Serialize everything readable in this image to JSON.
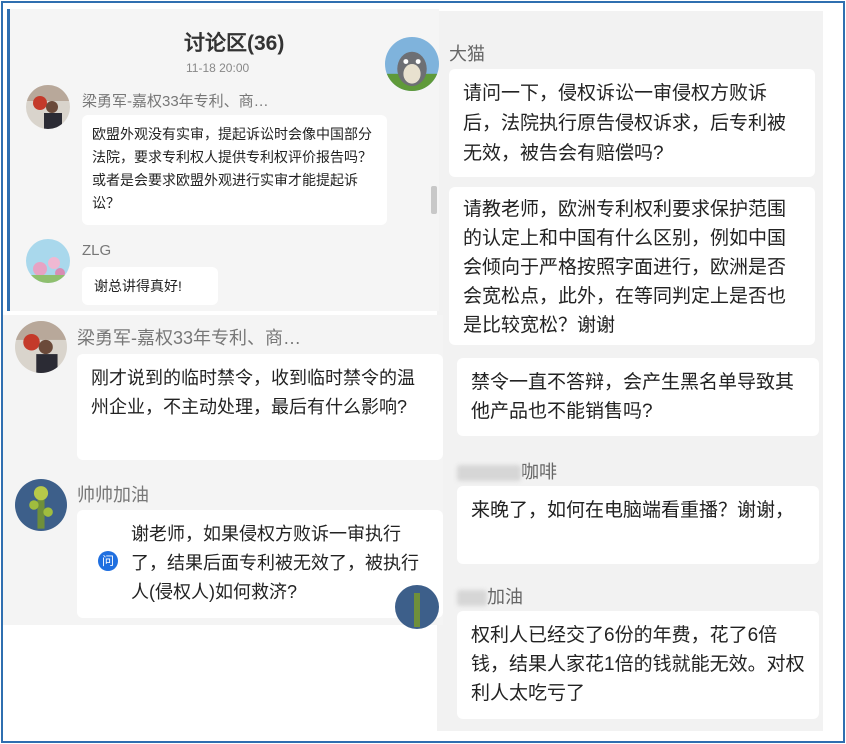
{
  "discussion": {
    "title": "讨论区(36)",
    "timestamp": "11-18 20:00"
  },
  "left_messages": [
    {
      "author": "梁勇军-嘉权33年专利、商…",
      "text": "欧盟外观没有实审，提起诉讼时会像中国部分法院，要求专利权人提供专利权评价报告吗？或者是会要求欧盟外观进行实审才能提起诉讼？",
      "avatar": "office-photo-avatar"
    },
    {
      "author": "ZLG",
      "text": "谢总讲得真好!",
      "avatar": "flower-avatar"
    },
    {
      "author": "梁勇军-嘉权33年专利、商…",
      "text": "刚才说到的临时禁令，收到临时禁令的温州企业，不主动处理，最后有什么影响?",
      "avatar": "office-photo-avatar"
    },
    {
      "author": "帅帅加油",
      "text": "谢老师，如果侵权方败诉一审执行了，结果后面专利被无效了，被执行人(侵权人)如何救济?",
      "avatar": "plant-avatar",
      "badge": "问"
    }
  ],
  "right_messages": [
    {
      "author": "大猫",
      "text": "请问一下，侵权诉讼一审侵权方败诉后，法院执行原告侵权诉求，后专利被无效，被告会有赔偿吗?",
      "avatar": "totoro-avatar"
    },
    {
      "author": "",
      "text": "请教老师，欧洲专利权利要求保护范围的认定上和中国有什么区别，例如中国会倾向于严格按照字面进行，欧洲是否会宽松点，此外，在等同判定上是否也是比较宽松？谢谢"
    },
    {
      "author": "",
      "text": "禁令一直不答辩，会产生黑名单导致其他产品也不能销售吗?"
    },
    {
      "author": "咖啡",
      "text": "来晚了，如何在电脑端看重播？谢谢，",
      "blurred_prefix": true
    },
    {
      "author": "加油",
      "text": "权利人已经交了6份的年费，花了6倍钱，结果人家花1倍的钱就能无效。对权利人太吃亏了",
      "blurred_prefix": true
    }
  ],
  "colors": {
    "frame": "#2f6fb0",
    "panel": "#f2f2f2",
    "badge": "#1f6fe0"
  }
}
